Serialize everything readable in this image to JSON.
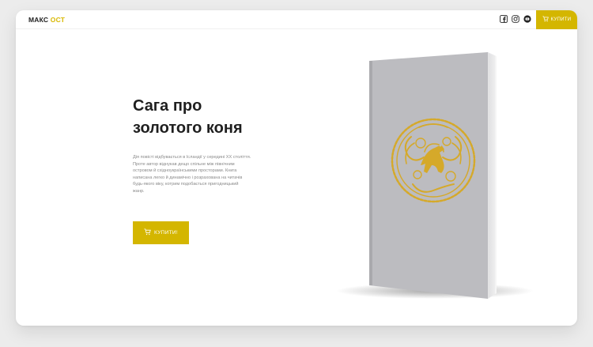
{
  "header": {
    "logo_main": "МАКС",
    "logo_accent": "ОСТ",
    "buy_label": "КУПИТИ",
    "socials": [
      {
        "icon": "facebook-icon"
      },
      {
        "icon": "instagram-icon"
      },
      {
        "icon": "youtube-icon"
      }
    ]
  },
  "hero": {
    "title_line1": "Сага про",
    "title_line2": "золотого коня",
    "description": [
      "Дія повісті відбувається в Ісландії у середині XX століття.",
      "Проте автор віднукав дещо спільне між північним",
      "островом й східноукраїнськими просторами. Книга",
      "написана легко й динамічно і розрахована на читачів",
      "будь-якого віку, котрим подобається пригодницький",
      "жанр."
    ],
    "buy_label": "КУПИТИ!"
  },
  "colors": {
    "accent": "#d4b600",
    "cover": "#bcbcc0",
    "ornament": "#d5a92a"
  }
}
